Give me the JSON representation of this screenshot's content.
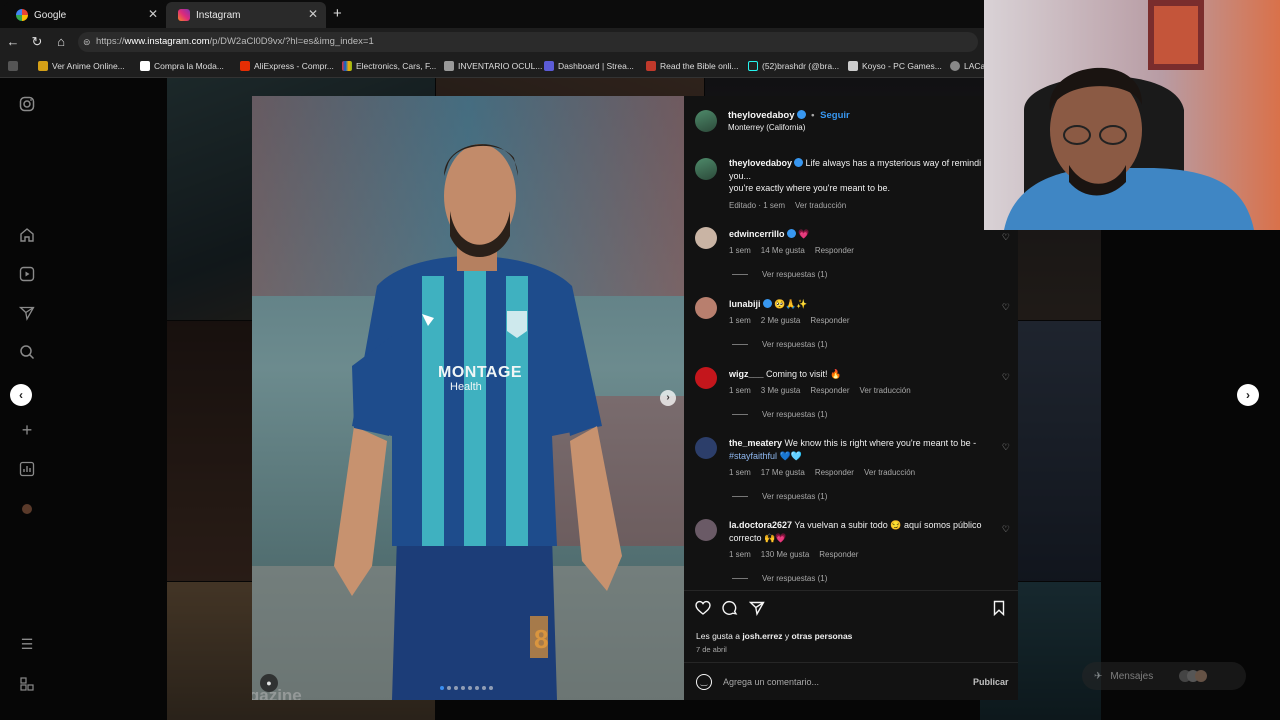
{
  "browser": {
    "tabs": [
      {
        "label": "Google",
        "active": false
      },
      {
        "label": "Instagram",
        "active": true
      }
    ],
    "url_prefix": "https://",
    "url_host": "www.instagram.com",
    "url_path": "/p/DW2aCl0D9vx/?hl=es&img_index=1",
    "bookmarks": [
      {
        "label": "Ver Anime Online...",
        "color": "#d4a017"
      },
      {
        "label": "Compra la Moda...",
        "color": "#ffffff"
      },
      {
        "label": "AliExpress - Compr...",
        "color": "#e62e04"
      },
      {
        "label": "Electronics, Cars, F...",
        "color": "#e53238"
      },
      {
        "label": "INVENTARIO OCUL...",
        "color": "#999999"
      },
      {
        "label": "Dashboard | Strea...",
        "color": "#5b5bd6"
      },
      {
        "label": "Read the Bible onli...",
        "color": "#c0392b"
      },
      {
        "label": "(52)brashdr (@bra...",
        "color": "#222222"
      },
      {
        "label": "Koyso - PC Games...",
        "color": "#cccccc"
      },
      {
        "label": "LACar",
        "color": "#888888"
      }
    ]
  },
  "post": {
    "username": "theylovedaboy",
    "follow_label": "Seguir",
    "location": "Monterrey (California)",
    "caption_user": "theylovedaboy",
    "caption_line1": "Life always has a mysterious way of remindi",
    "caption_line2": "you...",
    "caption_line3": "you're exactly where you're meant to be.",
    "caption_meta_edit": "Editado · 1 sem",
    "caption_meta_translate": "Ver traducción",
    "comments": [
      {
        "user": "edwincerrillo",
        "text": "💗",
        "time": "1 sem",
        "likes": "14 Me gusta",
        "reply": "Responder",
        "translate": "",
        "replies": "Ver respuestas (1)"
      },
      {
        "user": "lunabiji",
        "text": "🥺🙏✨",
        "time": "1 sem",
        "likes": "2 Me gusta",
        "reply": "Responder",
        "translate": "",
        "replies": "Ver respuestas (1)"
      },
      {
        "user": "wigz___",
        "text": "Coming to visit! 🔥",
        "time": "1 sem",
        "likes": "3 Me gusta",
        "reply": "Responder",
        "translate": "Ver traducción",
        "replies": "Ver respuestas (1)"
      },
      {
        "user": "the_meatery",
        "text": "We know this is right where you're meant to be -",
        "text2": "#stayfaithful 💙🩵",
        "time": "1 sem",
        "likes": "17 Me gusta",
        "reply": "Responder",
        "translate": "Ver traducción",
        "replies": "Ver respuestas (1)"
      },
      {
        "user": "la.doctora2627",
        "text": "Ya vuelvan a subir todo 😏 aquí somos público",
        "text2": "correcto 🙌💗",
        "time": "1 sem",
        "likes": "130 Me gusta",
        "reply": "Responder",
        "translate": "",
        "replies": "Ver respuestas (1)"
      }
    ],
    "likes_prefix": "Les gusta a ",
    "likes_user": "josh.errez",
    "likes_suffix": " y ",
    "likes_others": "otras personas",
    "date": "7 de abril",
    "comment_placeholder": "Agrega un comentario...",
    "publish_label": "Publicar"
  },
  "jersey_text": "MONTAGE",
  "jersey_text2": "Health",
  "jersey_number": "8",
  "watermark": "GameMagazine",
  "messages_label": "Mensajes"
}
